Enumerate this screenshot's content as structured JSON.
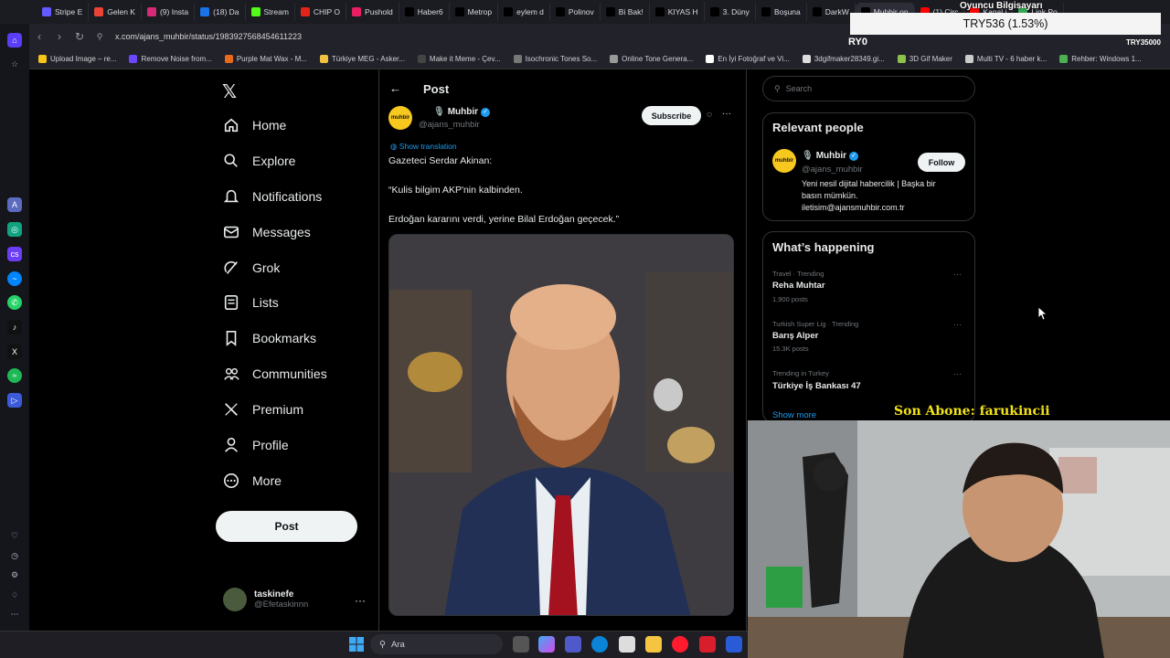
{
  "browser": {
    "tabs": [
      {
        "label": "Stripe E",
        "icon": "stripe-icon",
        "color": "#635bff"
      },
      {
        "label": "Gelen K",
        "icon": "gmail-icon",
        "color": "#ea4335"
      },
      {
        "label": "(9) Insta",
        "icon": "instagram-icon",
        "color": "#d62976"
      },
      {
        "label": "(18) Da",
        "icon": "chat-icon",
        "color": "#1a73e8"
      },
      {
        "label": "Stream",
        "icon": "kick-icon",
        "color": "#53fc18"
      },
      {
        "label": "CHIP O",
        "icon": "chip-icon",
        "color": "#e1251b"
      },
      {
        "label": "Pushold",
        "icon": "pushold-icon",
        "color": "#e91e63"
      },
      {
        "label": "Haber6",
        "icon": "x-icon",
        "color": "#000000"
      },
      {
        "label": "Metrop",
        "icon": "x-icon",
        "color": "#000000"
      },
      {
        "label": "eylem d",
        "icon": "x-icon",
        "color": "#000000"
      },
      {
        "label": "Polinov",
        "icon": "x-icon",
        "color": "#000000"
      },
      {
        "label": "Bi Bak!",
        "icon": "x-icon",
        "color": "#000000"
      },
      {
        "label": "KIYAS H",
        "icon": "x-icon",
        "color": "#000000"
      },
      {
        "label": "3. Düny",
        "icon": "x-icon",
        "color": "#000000"
      },
      {
        "label": "Boşuna",
        "icon": "x-icon",
        "color": "#000000"
      },
      {
        "label": "DarkW",
        "icon": "x-icon",
        "color": "#000000"
      },
      {
        "label": "Muhbir on",
        "icon": "x-icon",
        "color": "#000000",
        "active": true
      },
      {
        "label": "(1) Circ",
        "icon": "youtube-icon",
        "color": "#ff0000"
      },
      {
        "label": "Kanal i",
        "icon": "youtube-icon",
        "color": "#ff0000"
      },
      {
        "label": "Link Po",
        "icon": "link-icon",
        "color": "#34a853"
      }
    ],
    "url": "x.com/ajans_muhbir/status/1983927568454611223",
    "bookmarks": [
      {
        "label": "Upload Image – re...",
        "color": "#f5c518"
      },
      {
        "label": "Remove Noise from...",
        "color": "#6c47ff"
      },
      {
        "label": "Purple Mat Wax - M...",
        "color": "#e86a1a"
      },
      {
        "label": "Türkiye MEG - Asker...",
        "color": "#f0c040"
      },
      {
        "label": "Make it Meme - Çev...",
        "color": "#444444"
      },
      {
        "label": "Isochronic Tones So...",
        "color": "#777777"
      },
      {
        "label": "Online Tone Genera...",
        "color": "#999999"
      },
      {
        "label": "En İyi Fotoğraf ve Vi...",
        "color": "#ffffff"
      },
      {
        "label": "3dgifmaker28349.gi...",
        "color": "#dddddd"
      },
      {
        "label": "3D Gif Maker",
        "color": "#8bc34a"
      },
      {
        "label": "Multi TV - 6 haber k...",
        "color": "#cccccc"
      },
      {
        "label": "Rehber: Windows 1...",
        "color": "#4caf50"
      }
    ]
  },
  "nav": {
    "items": [
      {
        "label": "Home",
        "icon": "home-icon"
      },
      {
        "label": "Explore",
        "icon": "search-icon"
      },
      {
        "label": "Notifications",
        "icon": "bell-icon"
      },
      {
        "label": "Messages",
        "icon": "mail-icon"
      },
      {
        "label": "Grok",
        "icon": "grok-icon"
      },
      {
        "label": "Lists",
        "icon": "list-icon"
      },
      {
        "label": "Bookmarks",
        "icon": "bookmark-icon"
      },
      {
        "label": "Communities",
        "icon": "people-icon"
      },
      {
        "label": "Premium",
        "icon": "x-icon"
      },
      {
        "label": "Profile",
        "icon": "person-icon"
      },
      {
        "label": "More",
        "icon": "more-circle-icon"
      }
    ],
    "post_button": "Post",
    "account": {
      "name": "taskinefe",
      "handle": "@Efetaskinnn"
    }
  },
  "post": {
    "header_title": "Post",
    "author": {
      "name": "Muhbir",
      "handle": "@ajans_muhbir",
      "logo_text": "muhbir"
    },
    "subscribe_label": "Subscribe",
    "show_translation": "Show translation",
    "lines": [
      "Gazeteci Serdar Akinan:",
      "“Kulis bilgim AKP'nin kalbinden.",
      "Erdoğan kararını verdi, yerine Bilal Erdoğan geçecek.”"
    ]
  },
  "sidebar": {
    "search_placeholder": "Search",
    "relevant_people": {
      "title": "Relevant people",
      "name": "Muhbir",
      "handle": "@ajans_muhbir",
      "follow_label": "Follow",
      "bio_lines": [
        "Yeni nesil dijital habercilik | Başka bir",
        "basın mümkün.",
        "iletisim@ajansmuhbir.com.tr"
      ]
    },
    "happening": {
      "title": "What’s happening",
      "trends": [
        {
          "category": "Travel · Trending",
          "name": "Reha Muhtar",
          "count": "1,900 posts"
        },
        {
          "category": "Turkish Super Lig · Trending",
          "name": "Barış Alper",
          "count": "15.3K posts"
        },
        {
          "category": "Trending in Turkey",
          "name": "Türkiye İş Bankası 47",
          "count": ""
        }
      ],
      "show_more": "Show more"
    }
  },
  "overlay": {
    "ticker_top": "Oyuncu Bilgisayarı",
    "ticker": "TRY536 (1.53%)",
    "ticker_left": "RY0",
    "ticker_right": "TRY35000",
    "subscriber_label": "Son Abone: farukincii"
  },
  "taskbar": {
    "search_label": "Ara"
  },
  "colors": {
    "accent": "#1d9bf0",
    "brand_muhbir": "#f7c81e",
    "overlay_yellow": "#f2e21a"
  }
}
